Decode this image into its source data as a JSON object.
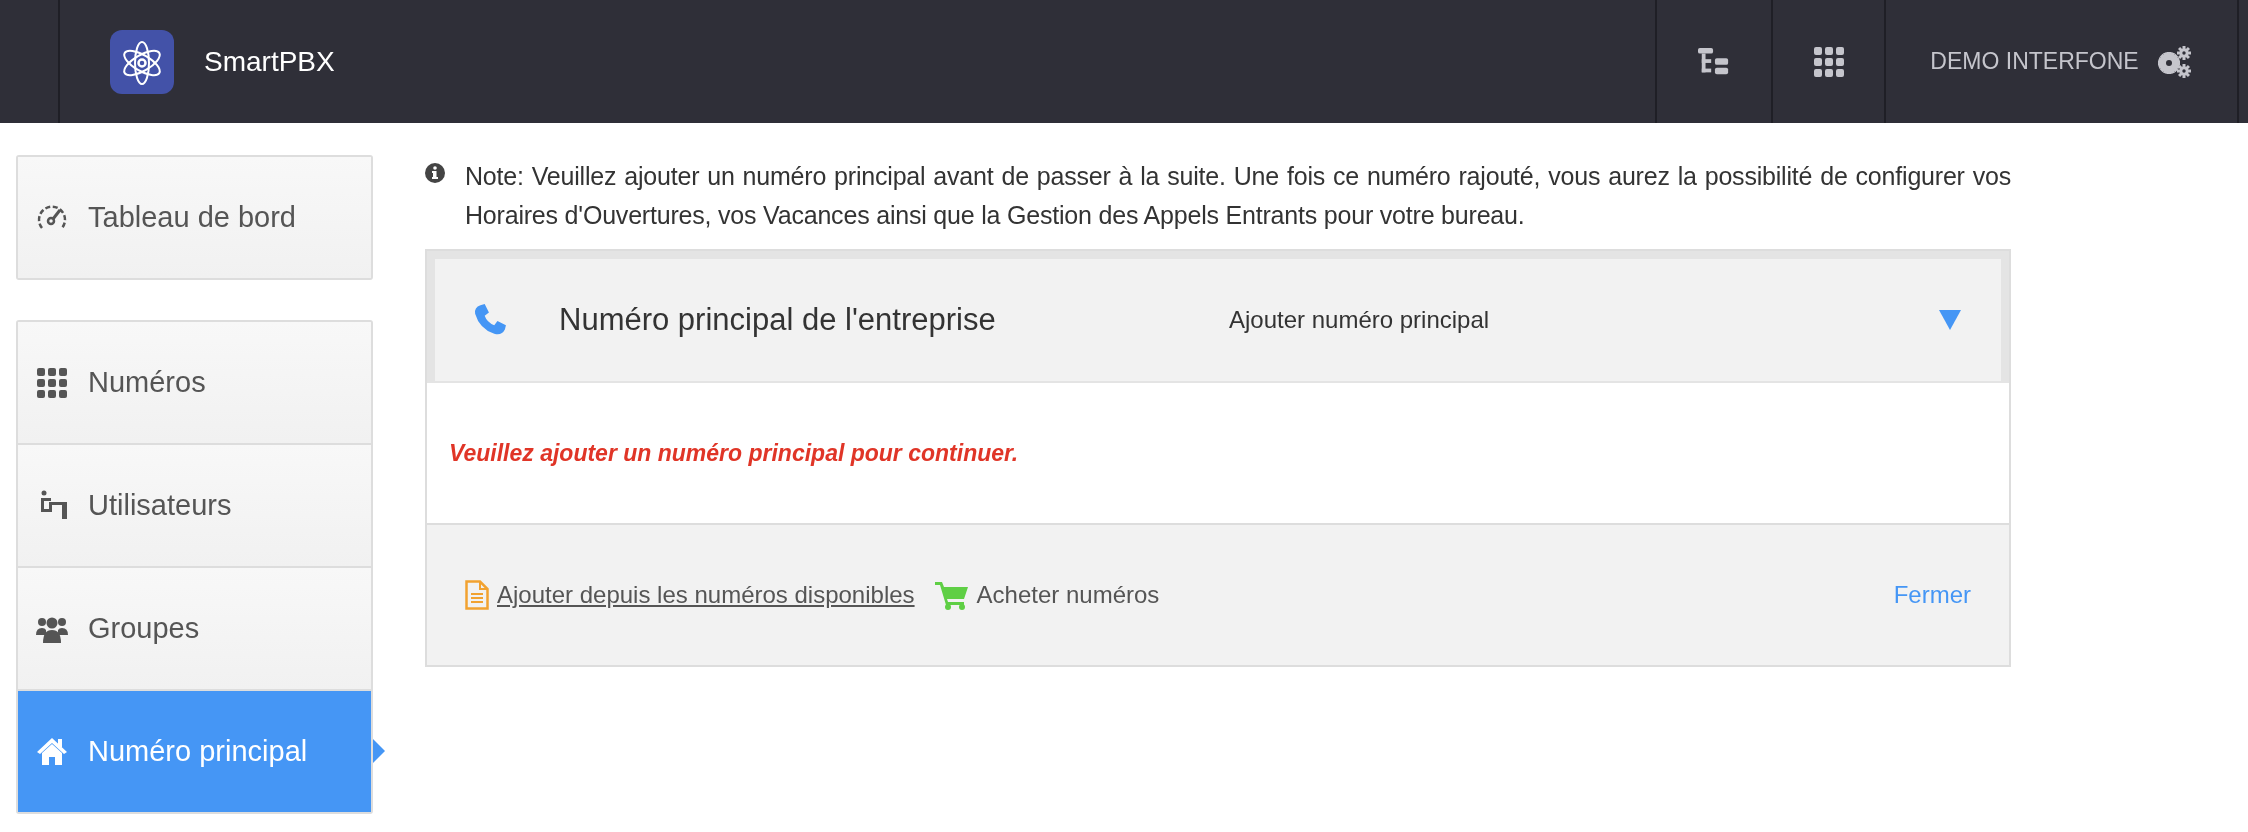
{
  "header": {
    "app_name": "SmartPBX",
    "account": "DEMO INTERFONE"
  },
  "sidebar": {
    "groups": [
      [
        {
          "label": "Tableau de bord",
          "selected": false
        }
      ],
      [
        {
          "label": "Numéros",
          "selected": false
        },
        {
          "label": "Utilisateurs",
          "selected": false
        },
        {
          "label": "Groupes",
          "selected": false
        },
        {
          "label": "Numéro principal",
          "selected": true
        }
      ]
    ]
  },
  "note": "Note: Veuillez ajouter un numéro principal avant de passer à la suite. Une fois ce numéro rajouté, vous aurez la possibilité de configurer vos Horaires d'Ouvertures, vos Vacances ainsi que la Gestion des Appels Entrants pour votre bureau.",
  "panel": {
    "title": "Numéro principal de l'entreprise",
    "value": "Ajouter numéro principal",
    "expanded": true,
    "warning": "Veuillez ajouter un numéro principal pour continuer.",
    "actions": [
      {
        "kind": "add",
        "label": "Ajouter depuis les numéros disponibles"
      },
      {
        "kind": "buy",
        "label": "Acheter numéros"
      },
      {
        "kind": "close",
        "label": "Fermer"
      }
    ]
  }
}
